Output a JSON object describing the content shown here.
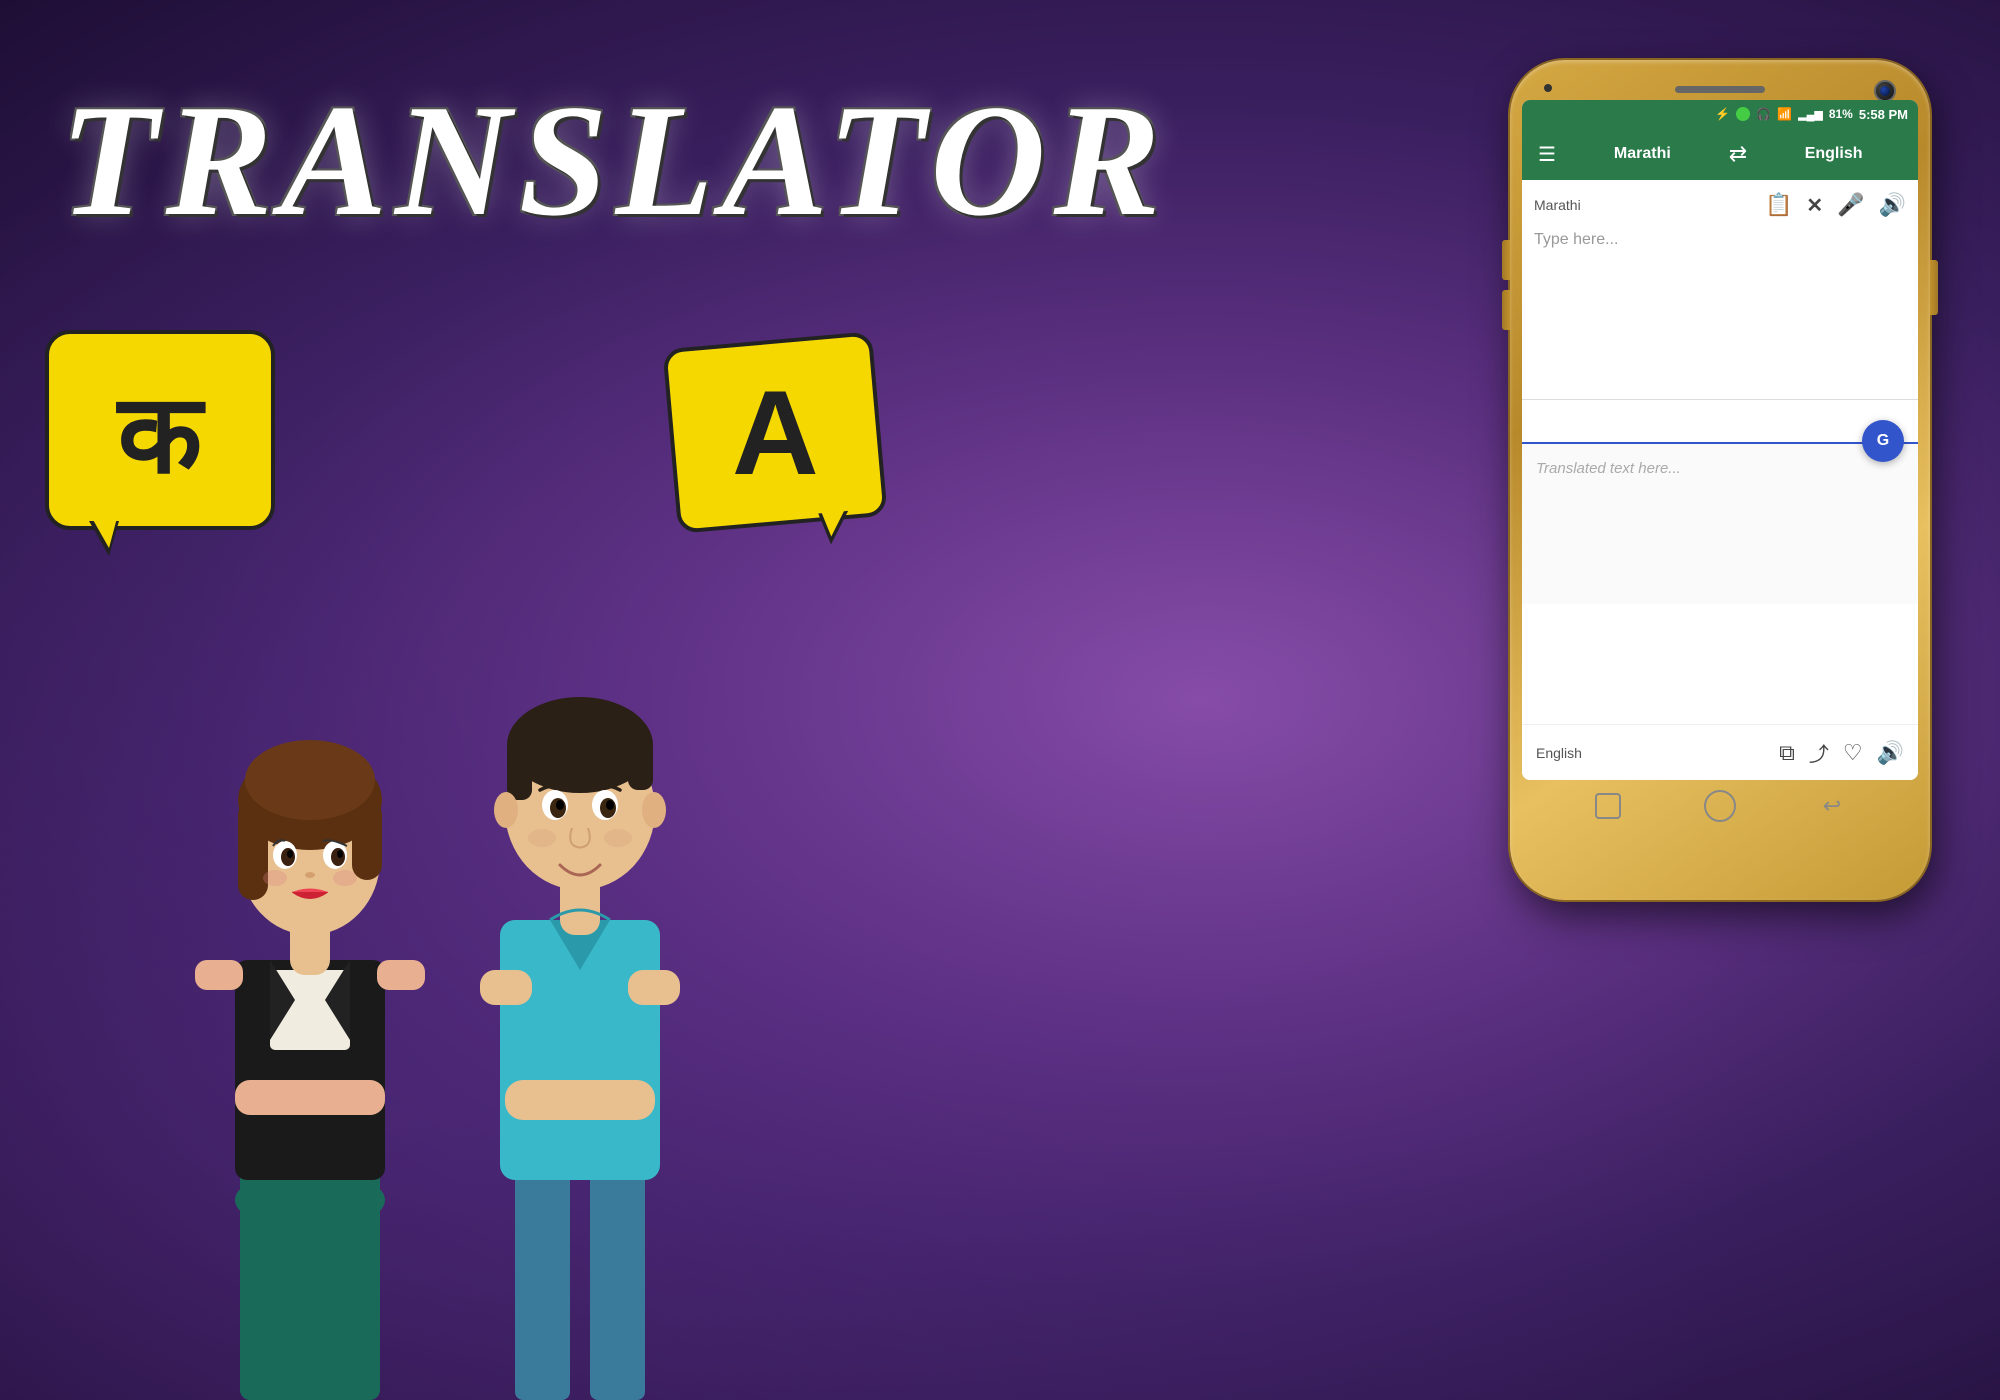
{
  "background": {
    "gradient": "radial purple"
  },
  "title": {
    "text": "TRANSLATOR"
  },
  "bubbles": {
    "left_char": "क",
    "right_char": "A"
  },
  "phone": {
    "status_bar": {
      "battery": "81%",
      "time": "5:58 PM",
      "wifi": "WiFi",
      "signal": "Signal"
    },
    "toolbar": {
      "menu_icon": "☰",
      "source_lang": "Marathi",
      "swap_icon": "⇄",
      "target_lang": "English"
    },
    "source_panel": {
      "lang_label": "Marathi",
      "clipboard_icon": "📋",
      "close_icon": "✕",
      "mic_icon": "🎤",
      "voice_icon": "🔊",
      "placeholder": "Type here..."
    },
    "output_panel": {
      "placeholder": "Translated text here..."
    },
    "output_footer": {
      "lang_label": "English",
      "copy_icon": "⧉",
      "share_icon": "◁",
      "heart_icon": "♡",
      "voice_icon": "🔊"
    },
    "nav": {
      "back_icon": "↩"
    }
  }
}
